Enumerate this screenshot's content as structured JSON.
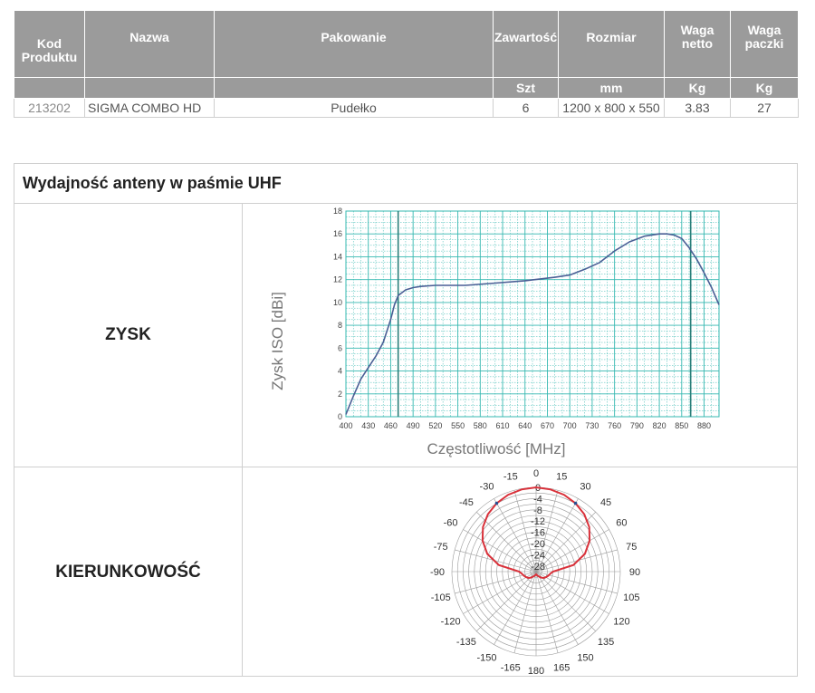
{
  "table": {
    "headers": {
      "kod": "Kod Produktu",
      "nazwa": "Nazwa",
      "pakowanie": "Pakowanie",
      "zawartosc": "Zawartość",
      "rozmiar": "Rozmiar",
      "waga_netto": "Waga netto",
      "waga_paczki": "Waga paczki"
    },
    "units": {
      "zawartosc": "Szt",
      "rozmiar": "mm",
      "waga_netto": "Kg",
      "waga_paczki": "Kg"
    },
    "row": {
      "kod": "213202",
      "nazwa": "SIGMA COMBO HD",
      "pakowanie": "Pudełko",
      "zawartosc": "6",
      "rozmiar": "1200 x 800 x 550",
      "waga_netto": "3.83",
      "waga_paczki": "27"
    }
  },
  "panel": {
    "title": "Wydajność anteny w paśmie UHF",
    "gain_label": "ZYSK",
    "directivity_label": "KIERUNKOWOŚĆ"
  },
  "chart_data": [
    {
      "type": "line",
      "xlabel": "Częstotliwość [MHz]",
      "ylabel": "Zysk ISO [dBi]",
      "xlim": [
        400,
        900
      ],
      "ylim": [
        0,
        18
      ],
      "xticks": [
        400,
        430,
        460,
        490,
        520,
        550,
        580,
        610,
        640,
        670,
        700,
        730,
        760,
        790,
        820,
        850,
        880
      ],
      "yticks": [
        0,
        2,
        4,
        6,
        8,
        10,
        12,
        14,
        16,
        18
      ],
      "markers_x": [
        470,
        862
      ],
      "grid": true,
      "color": "#4a5f95",
      "x": [
        400,
        410,
        420,
        430,
        440,
        450,
        460,
        465,
        470,
        480,
        490,
        500,
        520,
        560,
        600,
        640,
        680,
        700,
        720,
        740,
        760,
        780,
        800,
        820,
        830,
        840,
        850,
        860,
        870,
        880,
        890,
        900
      ],
      "y": [
        0.2,
        1.8,
        3.3,
        4.3,
        5.3,
        6.5,
        8.5,
        9.8,
        10.6,
        11.1,
        11.3,
        11.4,
        11.5,
        11.5,
        11.7,
        11.9,
        12.2,
        12.4,
        12.9,
        13.5,
        14.5,
        15.3,
        15.8,
        16.0,
        16.0,
        15.9,
        15.6,
        14.8,
        13.8,
        12.6,
        11.3,
        9.8
      ]
    },
    {
      "type": "polar",
      "angles": [
        0,
        15,
        30,
        45,
        60,
        75,
        90,
        105,
        120,
        135,
        150,
        165,
        180,
        -165,
        -150,
        -135,
        -120,
        -105,
        -90,
        -75,
        -60,
        -45,
        -30,
        -15
      ],
      "radial_ticks": [
        0,
        -4,
        -8,
        -12,
        -16,
        -20,
        -24,
        -28
      ],
      "color": "#d9313a",
      "pattern_angles": [
        0,
        10,
        20,
        30,
        40,
        50,
        60,
        70,
        80,
        90,
        100,
        110,
        120,
        130,
        140,
        150,
        160,
        170,
        180
      ],
      "pattern_db": [
        0,
        -0.3,
        -0.9,
        -1.9,
        -3.3,
        -5.3,
        -8.0,
        -11.5,
        -16.5,
        -24,
        -25,
        -25.5,
        -26,
        -26.5,
        -27.2,
        -28,
        -28.5,
        -28.8,
        -29
      ]
    }
  ]
}
